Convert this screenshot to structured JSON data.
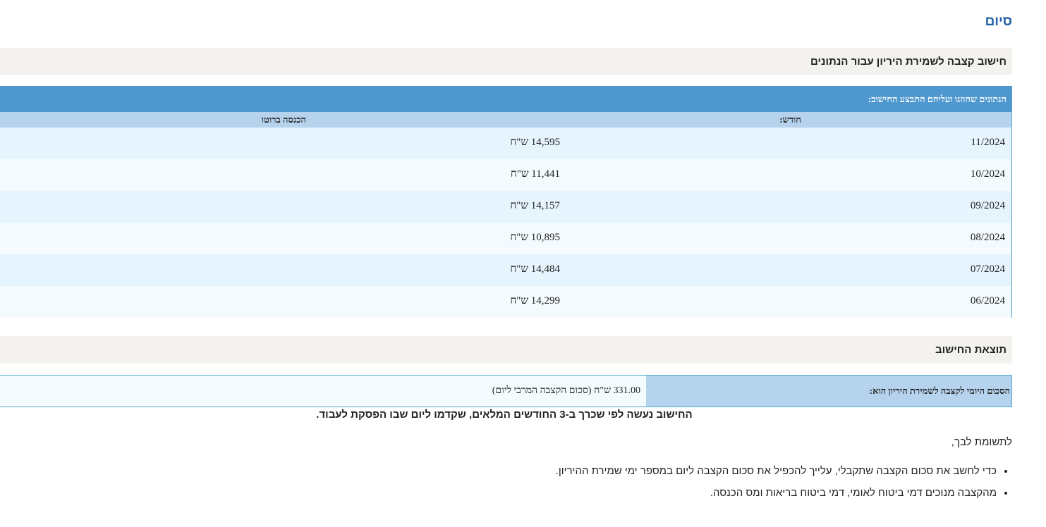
{
  "header": {
    "finish_link": "סיום"
  },
  "calc_section": {
    "title": "חישוב קצבה לשמירת היריון עבור הנתונים"
  },
  "table": {
    "title": "הנתונים שהוזנו ועליהם התבצע החישוב:",
    "col_month": "חודש:",
    "col_income": "הכנסה ברוטו",
    "rows": [
      {
        "month": "11/2024",
        "income": "14,595 ש\"ח"
      },
      {
        "month": "10/2024",
        "income": "11,441 ש\"ח"
      },
      {
        "month": "09/2024",
        "income": "14,157 ש\"ח"
      },
      {
        "month": "08/2024",
        "income": "10,895 ש\"ח"
      },
      {
        "month": "07/2024",
        "income": "14,484 ש\"ח"
      },
      {
        "month": "06/2024",
        "income": "14,299 ש\"ח"
      }
    ]
  },
  "result_section": {
    "title": "תוצאת החישוב",
    "label": "הסכום היומי לקצבה לשמירת היריון הוא:",
    "value": "331.00 ש\"ח (סכום הקצבה המרבי ליום)"
  },
  "notes": {
    "bold": "החישוב נעשה לפי שכרך ב-3 החודשים המלאים, שקדמו ליום שבו הפסקת לעבוד.",
    "intro": "לתשומת לבך,",
    "bullets": [
      "כדי לחשב את סכום הקצבה שתקבלי, עלייך להכפיל את סכום הקצבה ליום במספר ימי שמירת ההיריון.",
      "מהקצבה מנוכים דמי ביטוח לאומי, דמי ביטוח בריאות ומס הכנסה."
    ]
  }
}
